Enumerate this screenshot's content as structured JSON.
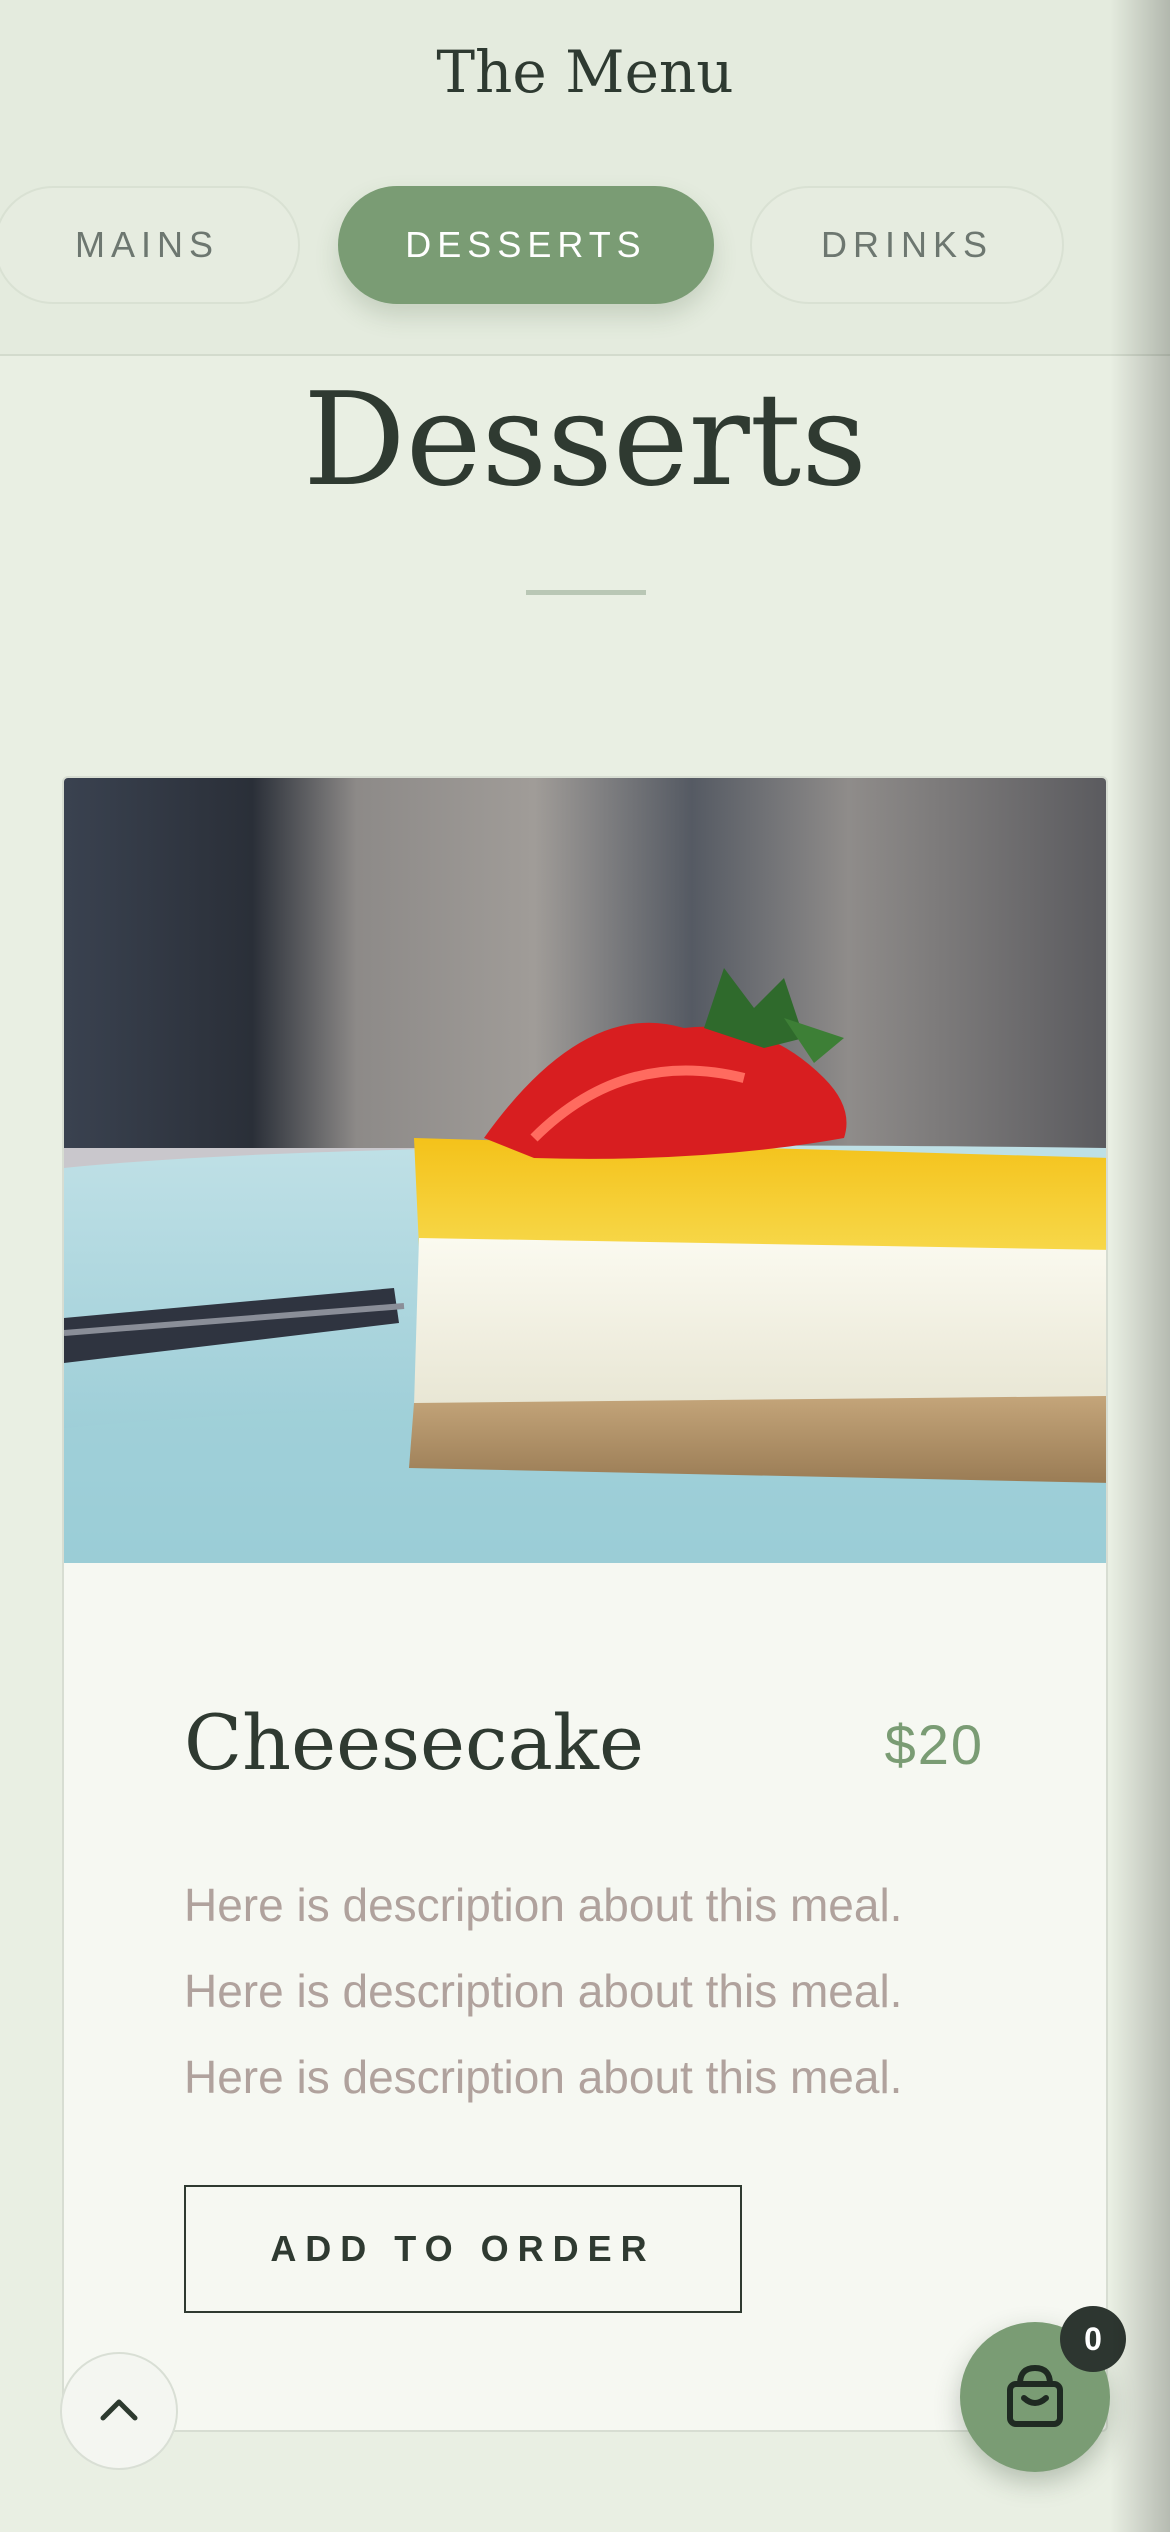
{
  "header": {
    "title": "The Menu"
  },
  "tabs": [
    {
      "label": "MAINS",
      "active": false
    },
    {
      "label": "DESSERTS",
      "active": true
    },
    {
      "label": "DRINKS",
      "active": false
    }
  ],
  "section": {
    "title": "Desserts"
  },
  "menu_item": {
    "name": "Cheesecake",
    "price": "$20",
    "description": [
      "Here is description about this meal.",
      "Here is description about this meal.",
      "Here is description about this meal."
    ],
    "add_button_label": "ADD TO ORDER"
  },
  "cart": {
    "count": "0"
  },
  "colors": {
    "accent": "#7a9c74",
    "background": "#e9efe3",
    "text_dark": "#2f3a31",
    "description": "#b0a29d"
  }
}
